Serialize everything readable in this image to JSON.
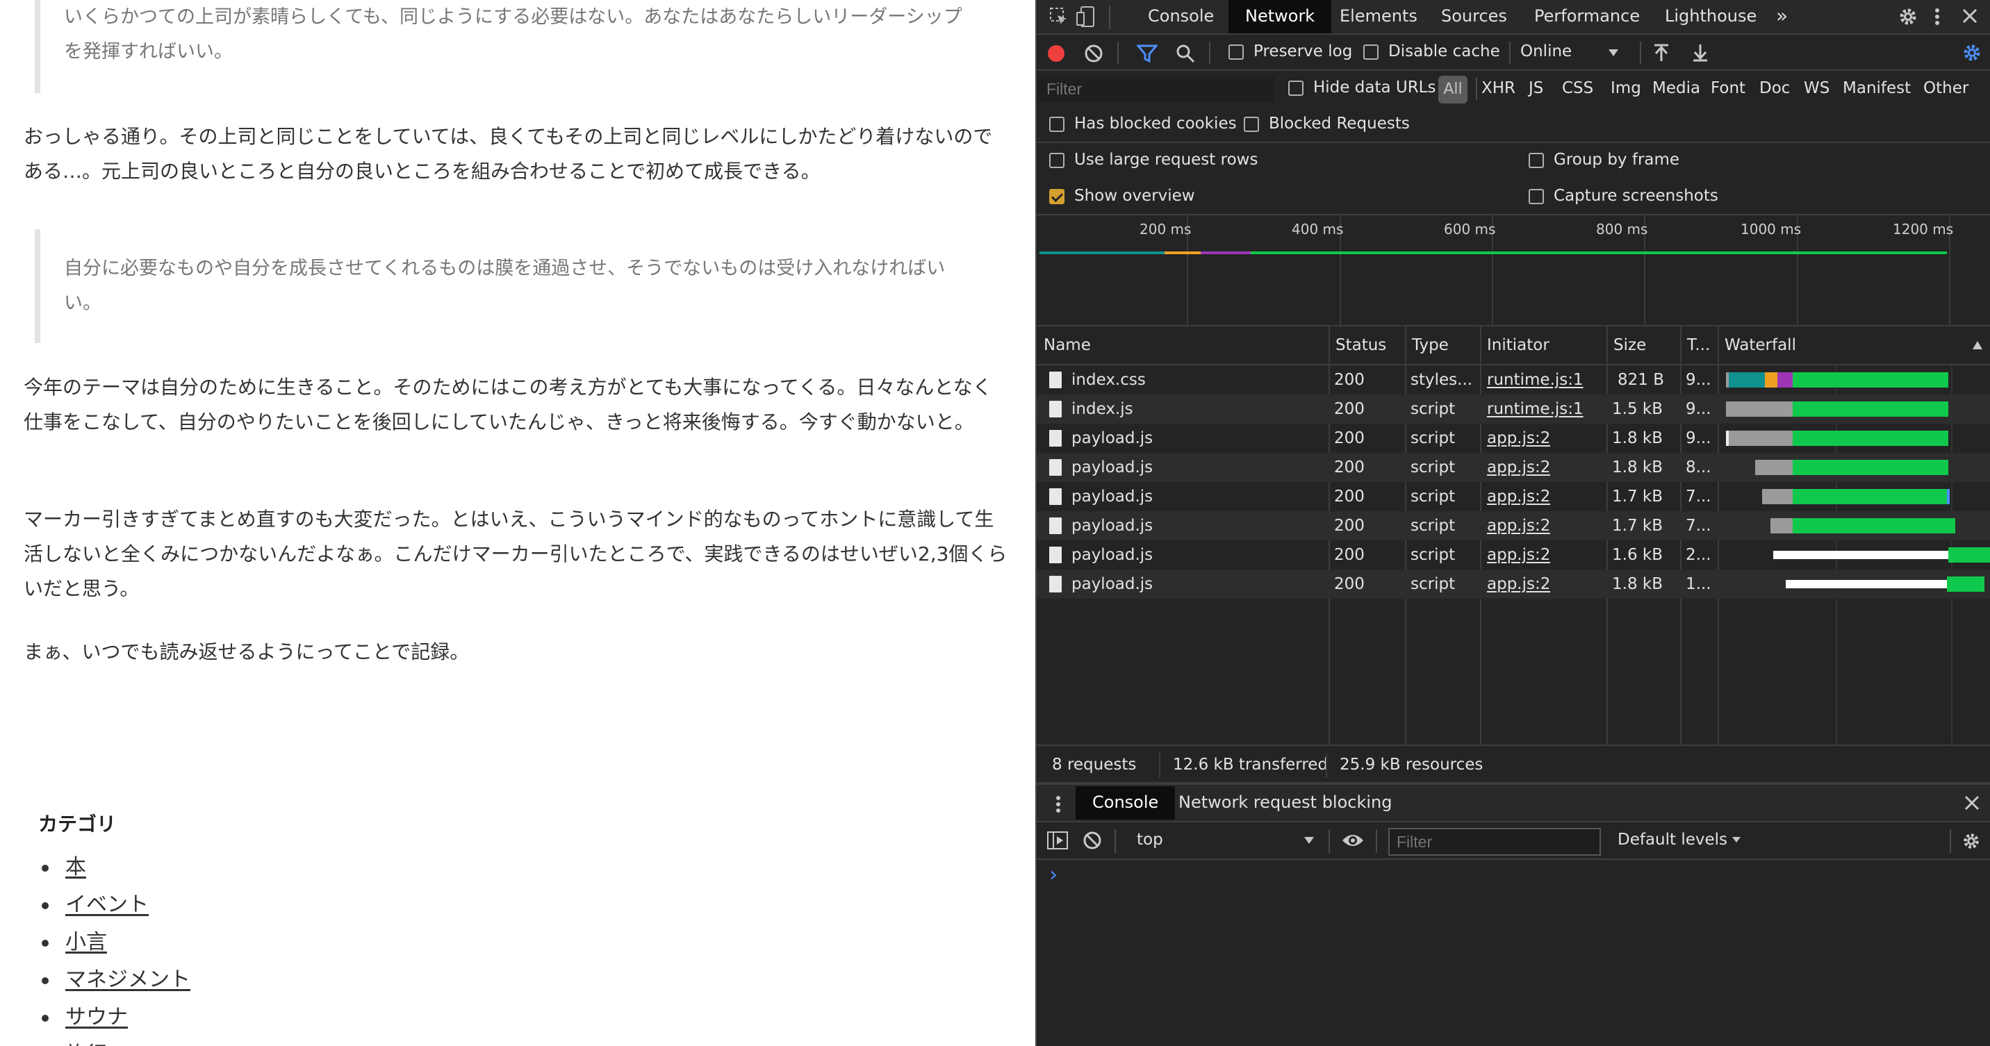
{
  "article": {
    "quote1": "いくらかつての上司が素晴らしくても、同じようにする必要はない。あなたはあなたらしいリーダーシップを発揮すればいい。",
    "para1": "おっしゃる通り。その上司と同じことをしていては、良くてもその上司と同じレベルにしかたどり着けないのである…。元上司の良いところと自分の良いところを組み合わせることで初めて成長できる。",
    "quote2": "自分に必要なものや自分を成長させてくれるものは膜を通過させ、そうでないものは受け入れなければいい。",
    "para2": "今年のテーマは自分のために生きること。そのためにはこの考え方がとても大事になってくる。日々なんとなく仕事をこなして、自分のやりたいことを後回しにしていたんじゃ、きっと将来後悔する。今すぐ動かないと。",
    "para3": "マーカー引きすぎてまとめ直すのも大変だった。とはいえ、こういうマインド的なものってホントに意識して生活しないと全くみにつかないんだよなぁ。こんだけマーカー引いたところで、実践できるのはせいぜい2,3個くらいだと思う。",
    "para4": "まぁ、いつでも読み返せるようにってことで記録。",
    "category_heading": "カテゴリ",
    "categories": [
      "本",
      "イベント",
      "小言",
      "マネジメント",
      "サウナ",
      "旅行"
    ]
  },
  "devtools": {
    "tabs": [
      "Console",
      "Network",
      "Elements",
      "Sources",
      "Performance",
      "Lighthouse"
    ],
    "active_tab": "Network",
    "more_tabs": "»",
    "toolbar": {
      "preserve_log": "Preserve log",
      "disable_cache": "Disable cache",
      "throttle": "Online"
    },
    "filter": {
      "placeholder": "Filter",
      "hide_data_urls": "Hide data URLs",
      "all": "All",
      "types": [
        "XHR",
        "JS",
        "CSS",
        "Img",
        "Media",
        "Font",
        "Doc",
        "WS",
        "Manifest",
        "Other"
      ],
      "has_blocked_cookies": "Has blocked cookies",
      "blocked_requests": "Blocked Requests"
    },
    "settings": {
      "large_rows": "Use large request rows",
      "group_by_frame": "Group by frame",
      "show_overview": "Show overview",
      "capture_screenshots": "Capture screenshots"
    },
    "overview_ticks": [
      "200 ms",
      "400 ms",
      "600 ms",
      "800 ms",
      "1000 ms",
      "1200 ms"
    ],
    "columns": [
      "Name",
      "Status",
      "Type",
      "Initiator",
      "Size",
      "T...",
      "Waterfall"
    ],
    "requests": [
      {
        "name": "index.css",
        "status": "200",
        "type": "styles...",
        "initiator": "runtime.js:1",
        "size": "821 B",
        "time": "9..."
      },
      {
        "name": "index.js",
        "status": "200",
        "type": "script",
        "initiator": "runtime.js:1",
        "size": "1.5 kB",
        "time": "9..."
      },
      {
        "name": "payload.js",
        "status": "200",
        "type": "script",
        "initiator": "app.js:2",
        "size": "1.8 kB",
        "time": "9..."
      },
      {
        "name": "payload.js",
        "status": "200",
        "type": "script",
        "initiator": "app.js:2",
        "size": "1.8 kB",
        "time": "8..."
      },
      {
        "name": "payload.js",
        "status": "200",
        "type": "script",
        "initiator": "app.js:2",
        "size": "1.7 kB",
        "time": "7..."
      },
      {
        "name": "payload.js",
        "status": "200",
        "type": "script",
        "initiator": "app.js:2",
        "size": "1.7 kB",
        "time": "7..."
      },
      {
        "name": "payload.js",
        "status": "200",
        "type": "script",
        "initiator": "app.js:2",
        "size": "1.6 kB",
        "time": "2..."
      },
      {
        "name": "payload.js",
        "status": "200",
        "type": "script",
        "initiator": "app.js:2",
        "size": "1.8 kB",
        "time": "1..."
      }
    ],
    "status_bar": {
      "requests": "8 requests",
      "transferred": "12.6 kB transferred",
      "resources": "25.9 kB resources"
    },
    "drawer": {
      "tabs": [
        "Console",
        "Network request blocking"
      ],
      "context": "top",
      "filter_placeholder": "Filter",
      "levels": "Default levels",
      "prompt": "›"
    },
    "colors": {
      "record": "#ef3e3e",
      "accent": "#4c8ef7",
      "waterfall_green": "#10c94c",
      "waterfall_queue": "#9a9a9a",
      "waterfall_teal": "#0f918f",
      "waterfall_orange": "#f0a021",
      "waterfall_purple": "#9c36b5",
      "checkbox_checked": "#d59f2f"
    }
  }
}
